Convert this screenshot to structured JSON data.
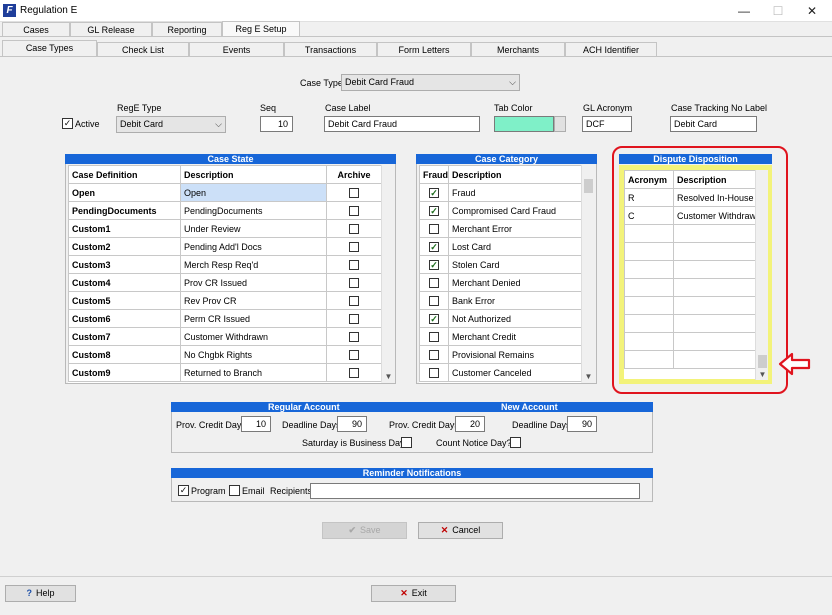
{
  "window": {
    "icon_letter": "F",
    "title": "Regulation E",
    "minimize": "—",
    "maximize": "☐",
    "close": "✕"
  },
  "tabs_main": [
    "Cases",
    "GL Release",
    "Reporting",
    "Reg E Setup"
  ],
  "tabs_sub": [
    "Case Types",
    "Check List",
    "Events",
    "Transactions",
    "Form Letters",
    "Merchants",
    "ACH Identifier"
  ],
  "case_type": {
    "label": "Case Type",
    "value": "Debit Card Fraud"
  },
  "form": {
    "active_label": "Active",
    "active_checked": "✓",
    "rege_type_label": "RegE Type",
    "rege_type_value": "Debit Card",
    "seq_label": "Seq",
    "seq_value": "10",
    "case_label_label": "Case Label",
    "case_label_value": "Debit Card Fraud",
    "tab_color_label": "Tab Color",
    "tab_color_value": "#7ff0c8",
    "gl_acronym_label": "GL Acronym",
    "gl_acronym_value": "DCF",
    "tracking_label": "Case Tracking No Label",
    "tracking_value": "Debit Card"
  },
  "case_state": {
    "title": "Case State",
    "headers": [
      "Case Definition",
      "Description",
      "Archive"
    ],
    "rows": [
      {
        "def": "Open",
        "desc": "Open"
      },
      {
        "def": "PendingDocuments",
        "desc": "PendingDocuments"
      },
      {
        "def": "Custom1",
        "desc": "Under Review"
      },
      {
        "def": "Custom2",
        "desc": "Pending Add'l Docs"
      },
      {
        "def": "Custom3",
        "desc": "Merch Resp Req'd"
      },
      {
        "def": "Custom4",
        "desc": "Prov CR Issued"
      },
      {
        "def": "Custom5",
        "desc": "Rev Prov CR"
      },
      {
        "def": "Custom6",
        "desc": "Perm CR Issued"
      },
      {
        "def": "Custom7",
        "desc": "Customer Withdrawn"
      },
      {
        "def": "Custom8",
        "desc": "No Chgbk Rights"
      },
      {
        "def": "Custom9",
        "desc": "Returned to Branch"
      }
    ]
  },
  "case_category": {
    "title": "Case Category",
    "headers": [
      "Fraud",
      "Description"
    ],
    "check_mark": "✓",
    "rows": [
      {
        "fraud": true,
        "desc": "Fraud"
      },
      {
        "fraud": true,
        "desc": "Compromised Card Fraud"
      },
      {
        "fraud": false,
        "desc": "Merchant Error"
      },
      {
        "fraud": true,
        "desc": "Lost Card"
      },
      {
        "fraud": true,
        "desc": "Stolen Card"
      },
      {
        "fraud": false,
        "desc": "Merchant Denied"
      },
      {
        "fraud": false,
        "desc": "Bank Error"
      },
      {
        "fraud": true,
        "desc": "Not Authorized"
      },
      {
        "fraud": false,
        "desc": "Merchant Credit"
      },
      {
        "fraud": false,
        "desc": "Provisional Remains"
      },
      {
        "fraud": false,
        "desc": "Customer Canceled"
      }
    ]
  },
  "dispute_disposition": {
    "title": "Dispute Disposition",
    "headers": [
      "Acronym",
      "Description"
    ],
    "rows": [
      {
        "acr": "R",
        "desc": "Resolved In-House"
      },
      {
        "acr": "C",
        "desc": "Customer Withdrawn"
      },
      {
        "acr": "",
        "desc": ""
      },
      {
        "acr": "",
        "desc": ""
      },
      {
        "acr": "",
        "desc": ""
      },
      {
        "acr": "",
        "desc": ""
      },
      {
        "acr": "",
        "desc": ""
      },
      {
        "acr": "",
        "desc": ""
      },
      {
        "acr": "",
        "desc": ""
      },
      {
        "acr": "",
        "desc": ""
      }
    ],
    "highlight_color": "#e0141e"
  },
  "accounts": {
    "regular_title": "Regular Account",
    "new_title": "New Account",
    "prov_credit_label": "Prov. Credit Days",
    "deadline_label": "Deadline Days",
    "regular_prov_credit": "10",
    "regular_deadline": "90",
    "new_prov_credit": "20",
    "new_deadline": "90",
    "saturday_label": "Saturday is Business Day?",
    "count_notice_label": "Count Notice Day?"
  },
  "reminders": {
    "title": "Reminder Notifications",
    "program_label": "Program",
    "program_checked": "✓",
    "email_label": "Email",
    "recipients_label": "Recipients",
    "recipients_value": ""
  },
  "buttons": {
    "save": "Save",
    "save_icon": "✔",
    "cancel": "Cancel",
    "cancel_icon": "✕",
    "help": "Help",
    "help_icon": "?",
    "exit": "Exit",
    "exit_icon": "✕"
  },
  "colors": {
    "group_header": "#1766d8",
    "selected_row": "#cce0f8",
    "dispute_yellow": "#f3f37a"
  }
}
